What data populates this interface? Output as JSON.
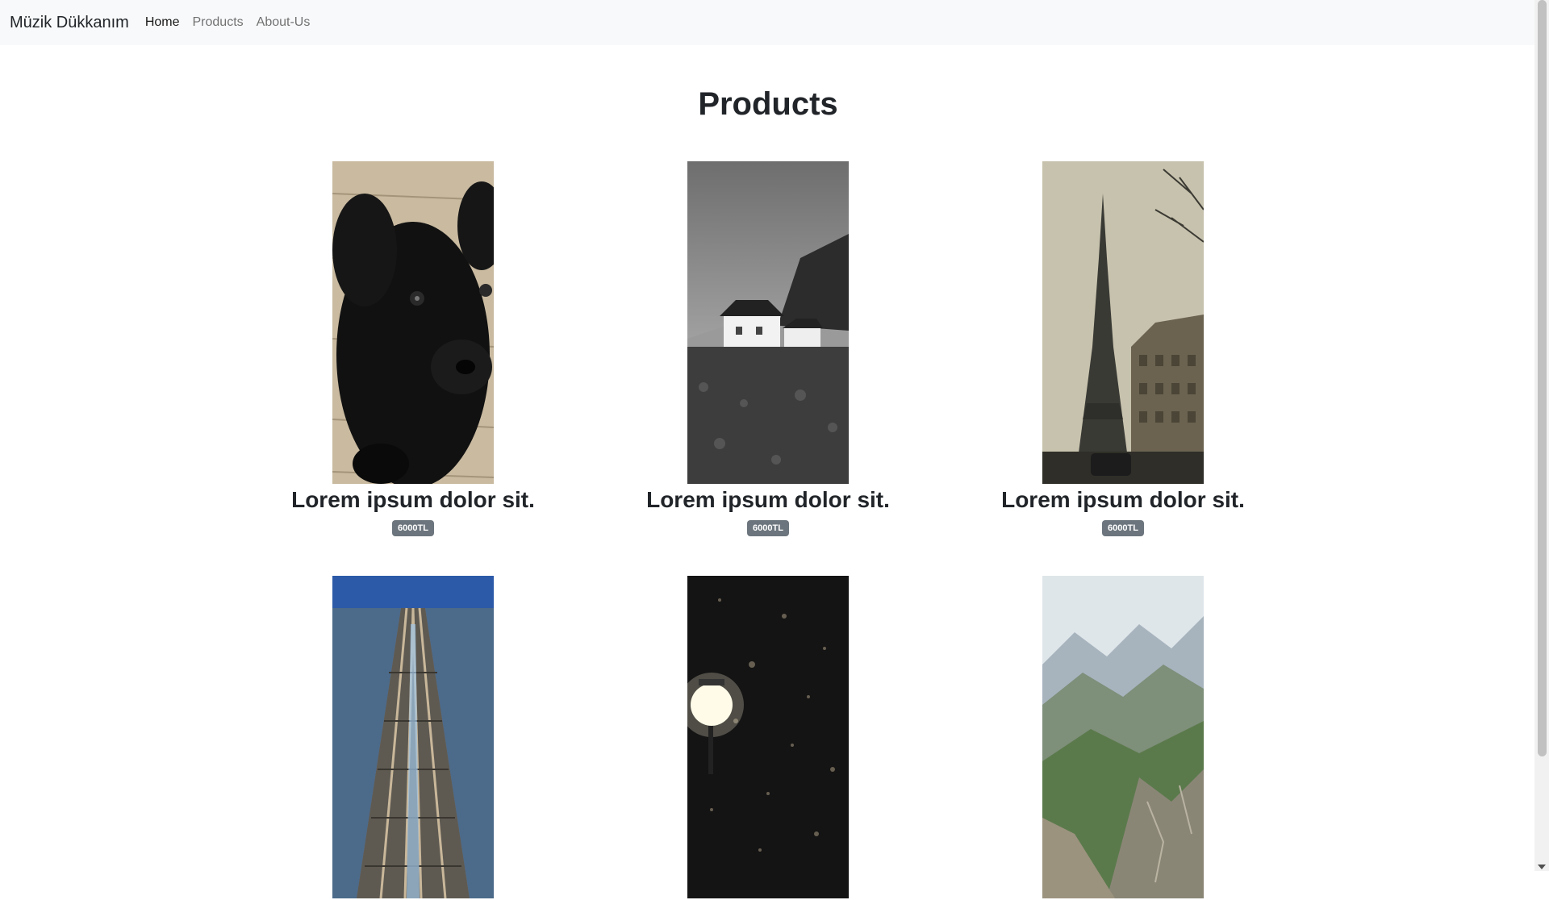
{
  "navbar": {
    "brand": "Müzik Dükkanım",
    "links": [
      "Home",
      "Products",
      "About-Us"
    ]
  },
  "page": {
    "title": "Products"
  },
  "products": [
    {
      "name": "Lorem ipsum dolor sit.",
      "price": "6000TL",
      "image": "black-puppy-photo"
    },
    {
      "name": "Lorem ipsum dolor sit.",
      "price": "6000TL",
      "image": "coastal-house-photo"
    },
    {
      "name": "Lorem ipsum dolor sit.",
      "price": "6000TL",
      "image": "eiffel-tower-photo"
    },
    {
      "name": "",
      "price": "",
      "image": "railway-tracks-photo"
    },
    {
      "name": "",
      "price": "",
      "image": "night-street-lamp-photo"
    },
    {
      "name": "",
      "price": "",
      "image": "mountain-range-photo"
    }
  ]
}
